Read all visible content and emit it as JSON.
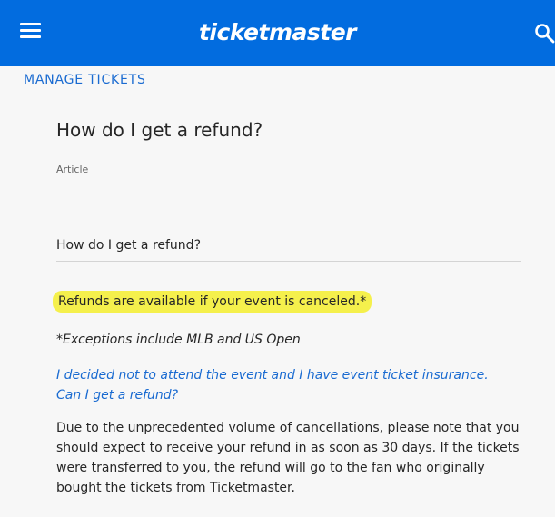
{
  "header": {
    "brand_name": "ticketmaster",
    "menu_icon": "hamburger-menu-icon",
    "search_icon": "search-icon",
    "brand_color": "#026cdf"
  },
  "breadcrumb": {
    "label": "MANAGE TICKETS"
  },
  "article": {
    "title": "How do I get a refund?",
    "type_label": "Article",
    "subtitle": "How do I get a refund?",
    "highlight": "Refunds are available if your event is canceled.*",
    "note": "*Exceptions include MLB and US Open",
    "question_link": "I decided not to attend the event and I have event ticket insurance. Can I get a refund?",
    "body": "Due to the unprecedented volume of cancellations, please note that you should expect to receive your refund in as soon as 30 days.  If the tickets were transferred to you, the refund will go to the fan who originally bought the tickets from Ticketmaster."
  },
  "colors": {
    "link": "#1a6bd1",
    "highlight": "#f5f04c",
    "background": "#f7f7f7"
  }
}
